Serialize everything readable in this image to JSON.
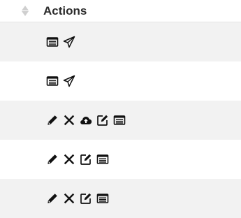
{
  "header": {
    "title": "Actions"
  },
  "rows": [
    {
      "icons": [
        "list-icon",
        "send-icon"
      ]
    },
    {
      "icons": [
        "list-icon",
        "send-icon"
      ]
    },
    {
      "icons": [
        "pencil-icon",
        "close-icon",
        "cloud-upload-icon",
        "edit-icon",
        "list-icon"
      ]
    },
    {
      "icons": [
        "pencil-icon",
        "close-icon",
        "edit-icon",
        "list-icon"
      ]
    },
    {
      "icons": [
        "pencil-icon",
        "close-icon",
        "edit-icon",
        "list-icon"
      ]
    }
  ],
  "colors": {
    "icon": "#111111",
    "row_shaded": "#f2f2f2",
    "sort_arrow": "#cfcfcf"
  }
}
